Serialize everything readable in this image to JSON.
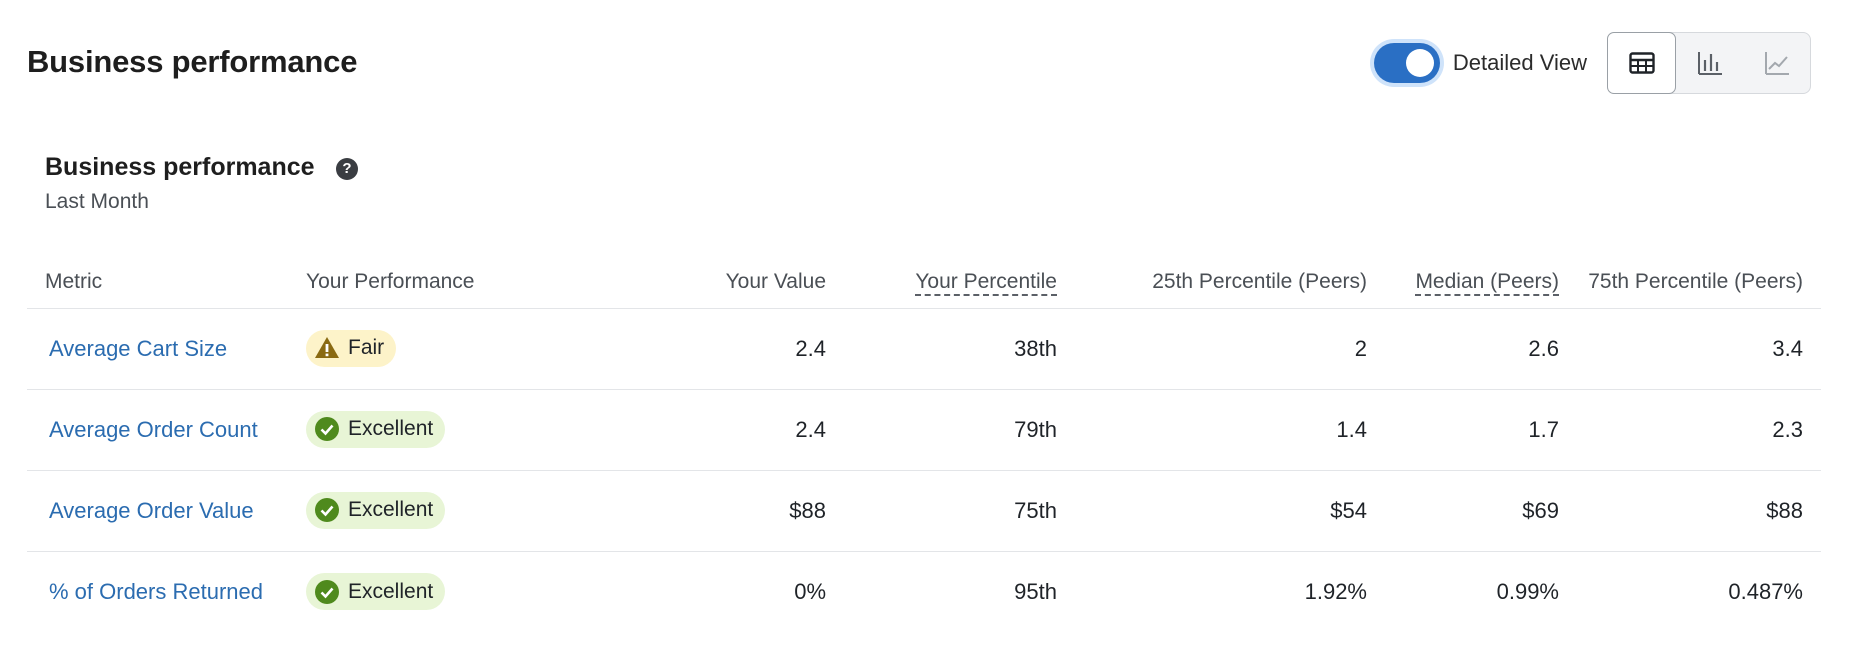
{
  "header": {
    "title": "Business performance"
  },
  "controls": {
    "toggle_label": "Detailed View",
    "toggle_on": true,
    "view_buttons": [
      {
        "name": "table-view",
        "icon": "table-icon",
        "active": true
      },
      {
        "name": "bar-chart-view",
        "icon": "bar-chart-icon",
        "active": false
      },
      {
        "name": "line-chart-view",
        "icon": "line-chart-icon",
        "active": false
      }
    ]
  },
  "card": {
    "title": "Business performance",
    "help_icon": "?",
    "subtitle": "Last Month"
  },
  "table": {
    "columns": [
      "Metric",
      "Your Performance",
      "Your Value",
      "Your Percentile",
      "25th Percentile (Peers)",
      "Median (Peers)",
      "75th Percentile (Peers)"
    ],
    "rows": [
      {
        "metric": "Average Cart Size",
        "performance": "Fair",
        "status": "warning",
        "value": "2.4",
        "percentile": "38th",
        "p25": "2",
        "median": "2.6",
        "p75": "3.4"
      },
      {
        "metric": "Average Order Count",
        "performance": "Excellent",
        "status": "success",
        "value": "2.4",
        "percentile": "79th",
        "p25": "1.4",
        "median": "1.7",
        "p75": "2.3"
      },
      {
        "metric": "Average Order Value",
        "performance": "Excellent",
        "status": "success",
        "value": "$88",
        "percentile": "75th",
        "p25": "$54",
        "median": "$69",
        "p75": "$88"
      },
      {
        "metric": "% of Orders Returned",
        "performance": "Excellent",
        "status": "success",
        "value": "0%",
        "percentile": "95th",
        "p25": "1.92%",
        "median": "0.99%",
        "p75": "0.487%"
      }
    ]
  },
  "colors": {
    "accent": "#2a6fc4",
    "link": "#2b6cb0",
    "fair_bg": "#fdf3c9",
    "fair_icon": "#8a6a12",
    "excellent_bg": "#e8f5d6",
    "excellent_icon": "#4f8a1d"
  }
}
